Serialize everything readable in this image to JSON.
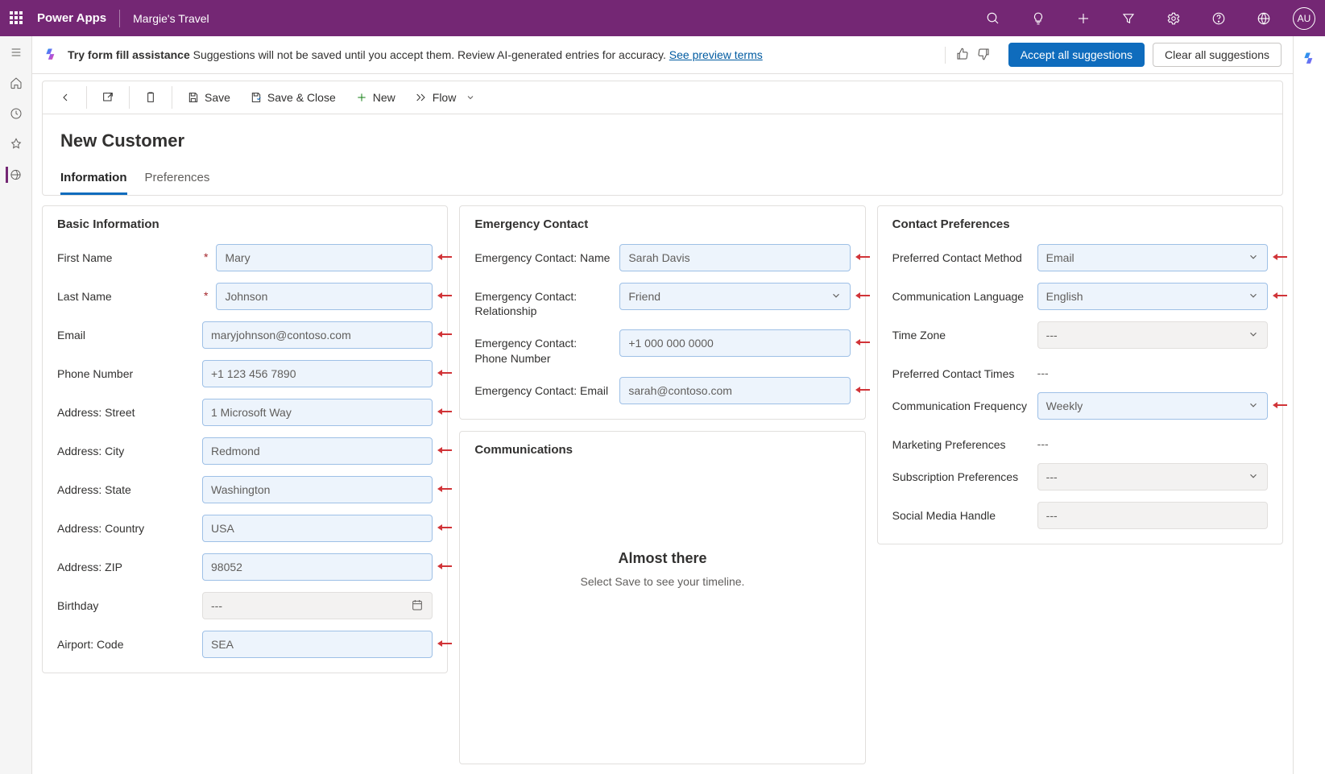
{
  "header": {
    "brand": "Power Apps",
    "appname": "Margie's Travel",
    "avatar": "AU"
  },
  "banner": {
    "bold": "Try form fill assistance",
    "text": " Suggestions will not be saved until you accept them. Review AI-generated entries for accuracy. ",
    "link": "See preview terms",
    "accept": "Accept all suggestions",
    "clear": "Clear all suggestions"
  },
  "commands": {
    "save": "Save",
    "saveclose": "Save & Close",
    "new": "New",
    "flow": "Flow"
  },
  "page": {
    "title": "New Customer",
    "tabs": [
      "Information",
      "Preferences"
    ],
    "activeTab": 0
  },
  "sections": {
    "basic": {
      "title": "Basic Information",
      "rows": [
        {
          "label": "First Name",
          "value": "Mary",
          "req": true,
          "sugg": true,
          "arrow": true
        },
        {
          "label": "Last Name",
          "value": "Johnson",
          "req": true,
          "sugg": true,
          "arrow": true
        },
        {
          "label": "Email",
          "value": "maryjohnson@contoso.com",
          "sugg": true,
          "arrow": true
        },
        {
          "label": "Phone Number",
          "value": "+1 123 456 7890",
          "sugg": true,
          "arrow": true
        },
        {
          "label": "Address: Street",
          "value": "1 Microsoft Way",
          "sugg": true,
          "arrow": true
        },
        {
          "label": "Address: City",
          "value": "Redmond",
          "sugg": true,
          "arrow": true
        },
        {
          "label": "Address: State",
          "value": "Washington",
          "sugg": true,
          "arrow": true
        },
        {
          "label": "Address: Country",
          "value": "USA",
          "sugg": true,
          "arrow": true
        },
        {
          "label": "Address: ZIP",
          "value": "98052",
          "sugg": true,
          "arrow": true
        },
        {
          "label": "Birthday",
          "value": "---",
          "readonly": true,
          "calendar": true
        },
        {
          "label": "Airport: Code",
          "value": "SEA",
          "sugg": true,
          "arrow": true
        }
      ]
    },
    "emergency": {
      "title": "Emergency Contact",
      "rows": [
        {
          "label": "Emergency Contact: Name",
          "value": "Sarah Davis",
          "sugg": true,
          "arrow": true
        },
        {
          "label": "Emergency Contact: Relationship",
          "value": "Friend",
          "select": true,
          "sugg": true,
          "arrow": true
        },
        {
          "label": "Emergency Contact: Phone Number",
          "value": "+1 000 000 0000",
          "sugg": true,
          "arrow": true
        },
        {
          "label": "Emergency Contact: Email",
          "value": "sarah@contoso.com",
          "sugg": true,
          "arrow": true
        }
      ]
    },
    "communications": {
      "title": "Communications",
      "empty_title": "Almost there",
      "empty_msg": "Select Save to see your timeline."
    },
    "prefs": {
      "title": "Contact Preferences",
      "rows": [
        {
          "label": "Preferred Contact Method",
          "value": "Email",
          "select": true,
          "sugg": true,
          "arrow": true
        },
        {
          "label": "Communication Language",
          "value": "English",
          "select": true,
          "sugg": true,
          "arrow": true
        },
        {
          "label": "Time Zone",
          "value": "---",
          "select": true,
          "readonly": true
        },
        {
          "label": "Preferred Contact Times",
          "value": "---",
          "text": true
        },
        {
          "label": "Communication Frequency",
          "value": "Weekly",
          "select": true,
          "sugg": true,
          "arrow": true
        },
        {
          "label": "Marketing Preferences",
          "value": "---",
          "text": true
        },
        {
          "label": "Subscription Preferences",
          "value": "---",
          "select": true,
          "readonly": true
        },
        {
          "label": "Social Media Handle",
          "value": "---",
          "readonly": true
        }
      ]
    }
  }
}
